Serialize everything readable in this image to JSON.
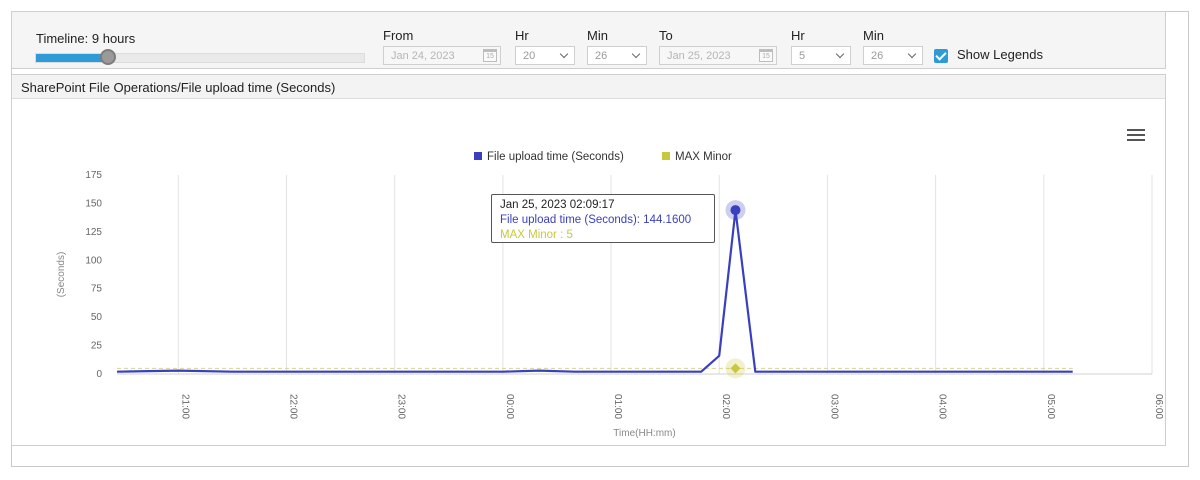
{
  "toolbar": {
    "timeline_label": "Timeline: 9 hours",
    "timeline_progress": 0.22,
    "from_label": "From",
    "from_date": "Jan 24, 2023",
    "from_hr_label": "Hr",
    "from_hr": "20",
    "from_min_label": "Min",
    "from_min": "26",
    "to_label": "To",
    "to_date": "Jan 25, 2023",
    "to_hr_label": "Hr",
    "to_hr": "5",
    "to_min_label": "Min",
    "to_min": "26",
    "show_legends_label": "Show Legends",
    "show_legends_checked": true,
    "calendar_icon_text": "15"
  },
  "panel": {
    "title": "SharePoint File Operations/File upload time (Seconds)"
  },
  "tooltip": {
    "date": "Jan 25, 2023 02:09:17",
    "series1": "File upload time (Seconds): 144.1600",
    "series2": "MAX Minor : 5"
  },
  "colors": {
    "series1": "#3a3fbf",
    "series2": "#c8c83c",
    "accent": "#2e9bd6"
  },
  "chart_data": {
    "type": "line",
    "xlabel": "Time(HH:mm)",
    "ylabel": "(Seconds)",
    "ylim": [
      0,
      175
    ],
    "yticks": [
      0,
      25,
      50,
      75,
      100,
      125,
      150,
      175
    ],
    "xticks": [
      "21:00",
      "22:00",
      "23:00",
      "00:00",
      "01:00",
      "02:00",
      "03:00",
      "04:00",
      "05:00",
      "06:00"
    ],
    "xlim": [
      "20:26",
      "06:00"
    ],
    "legend_position": "top-center",
    "grid": "vertical",
    "series": [
      {
        "name": "File upload time (Seconds)",
        "points": [
          [
            "20:26",
            2
          ],
          [
            "21:00",
            3
          ],
          [
            "21:30",
            2
          ],
          [
            "22:00",
            2
          ],
          [
            "22:30",
            2
          ],
          [
            "23:00",
            2
          ],
          [
            "23:30",
            2
          ],
          [
            "00:00",
            2
          ],
          [
            "00:20",
            3
          ],
          [
            "00:40",
            2
          ],
          [
            "01:00",
            2
          ],
          [
            "01:30",
            2
          ],
          [
            "01:50",
            2
          ],
          [
            "02:00",
            16
          ],
          [
            "02:09",
            144.16
          ],
          [
            "02:20",
            2
          ],
          [
            "02:40",
            2
          ],
          [
            "03:00",
            2
          ],
          [
            "03:30",
            2
          ],
          [
            "04:00",
            2
          ],
          [
            "04:30",
            2
          ],
          [
            "05:00",
            2
          ],
          [
            "05:16",
            2
          ]
        ]
      },
      {
        "name": "MAX Minor",
        "constant": 5
      }
    ]
  }
}
